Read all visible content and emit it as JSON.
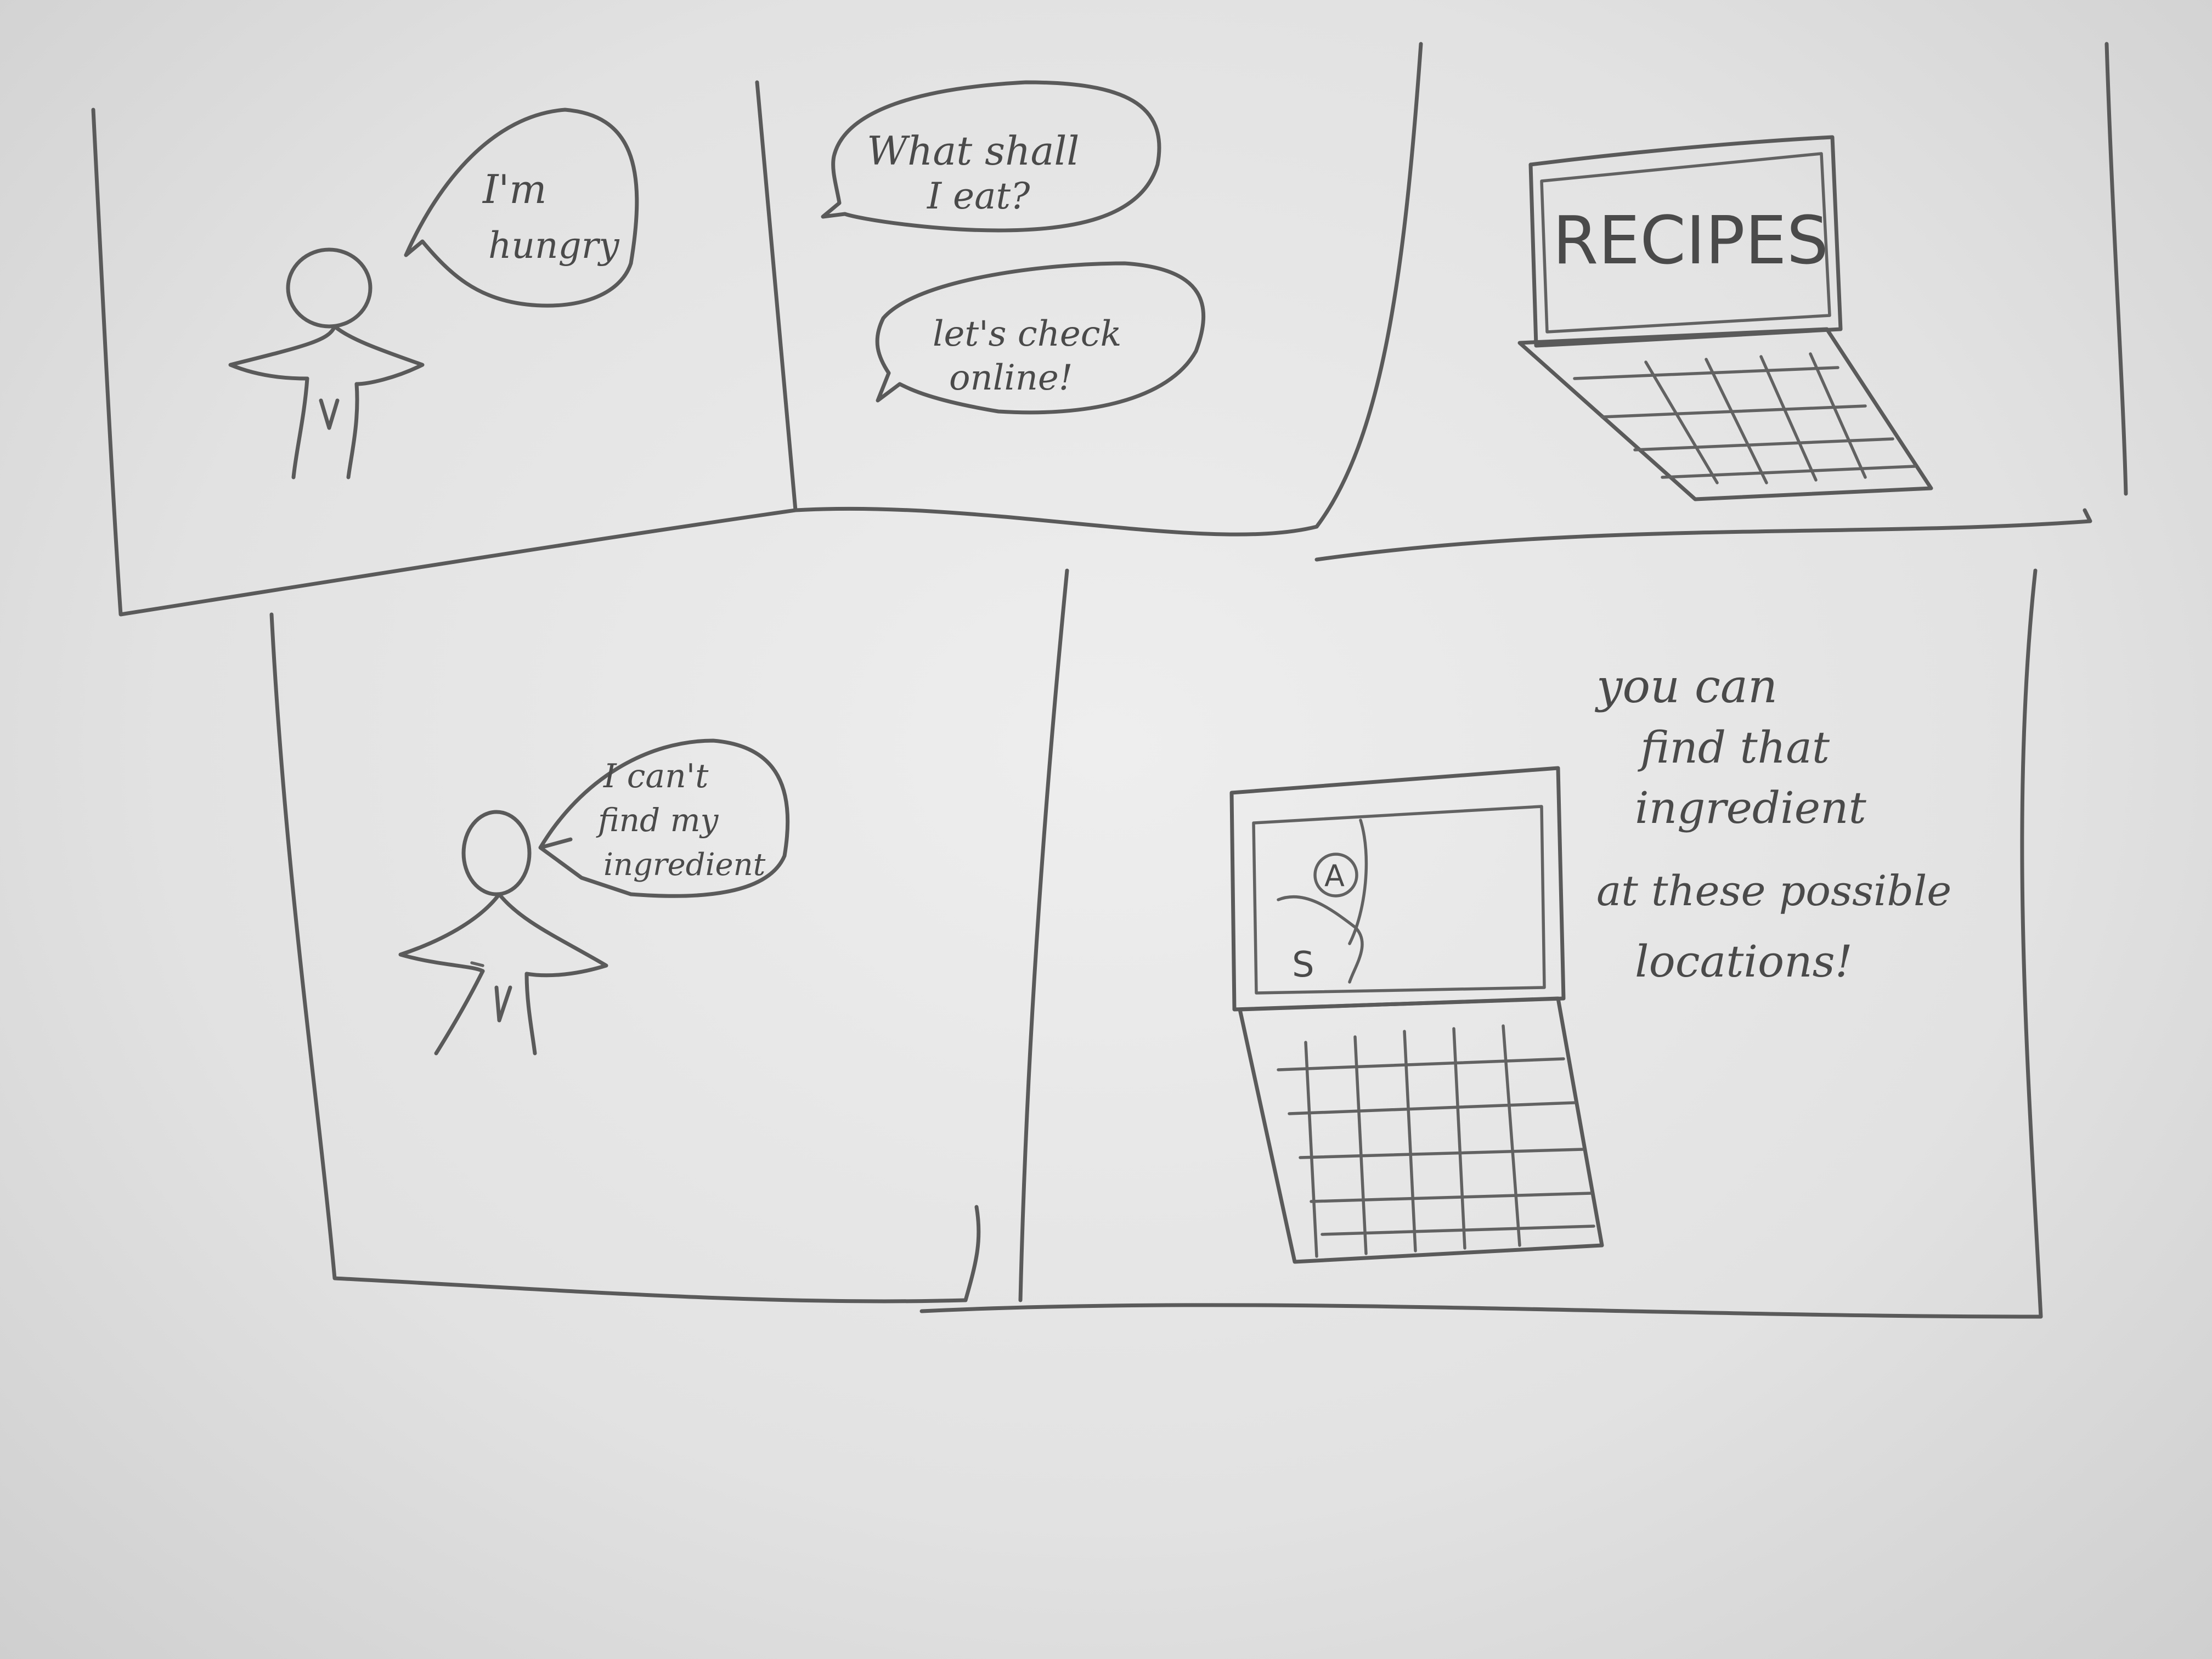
{
  "panel1": {
    "bubble_line1": "I'm",
    "bubble_line2": "hungry"
  },
  "panel2": {
    "bubble1_line1": "What shall",
    "bubble1_line2": "I eat?",
    "bubble2_line1": "let's check",
    "bubble2_line2": "online!"
  },
  "panel3": {
    "screen_text": "RECIPES"
  },
  "panel4": {
    "bubble_line1": "I can't",
    "bubble_line2": "find my",
    "bubble_line3": "ingredient"
  },
  "panel5": {
    "map_marker_a": "A",
    "map_marker_s": "S",
    "caption_line1": "you can",
    "caption_line2": "find that",
    "caption_line3": "ingredient",
    "caption_line4": "at these possible",
    "caption_line5": "locations!"
  },
  "colors": {
    "paper": "#e8e8e8",
    "pencil": "#5a5a5a"
  }
}
